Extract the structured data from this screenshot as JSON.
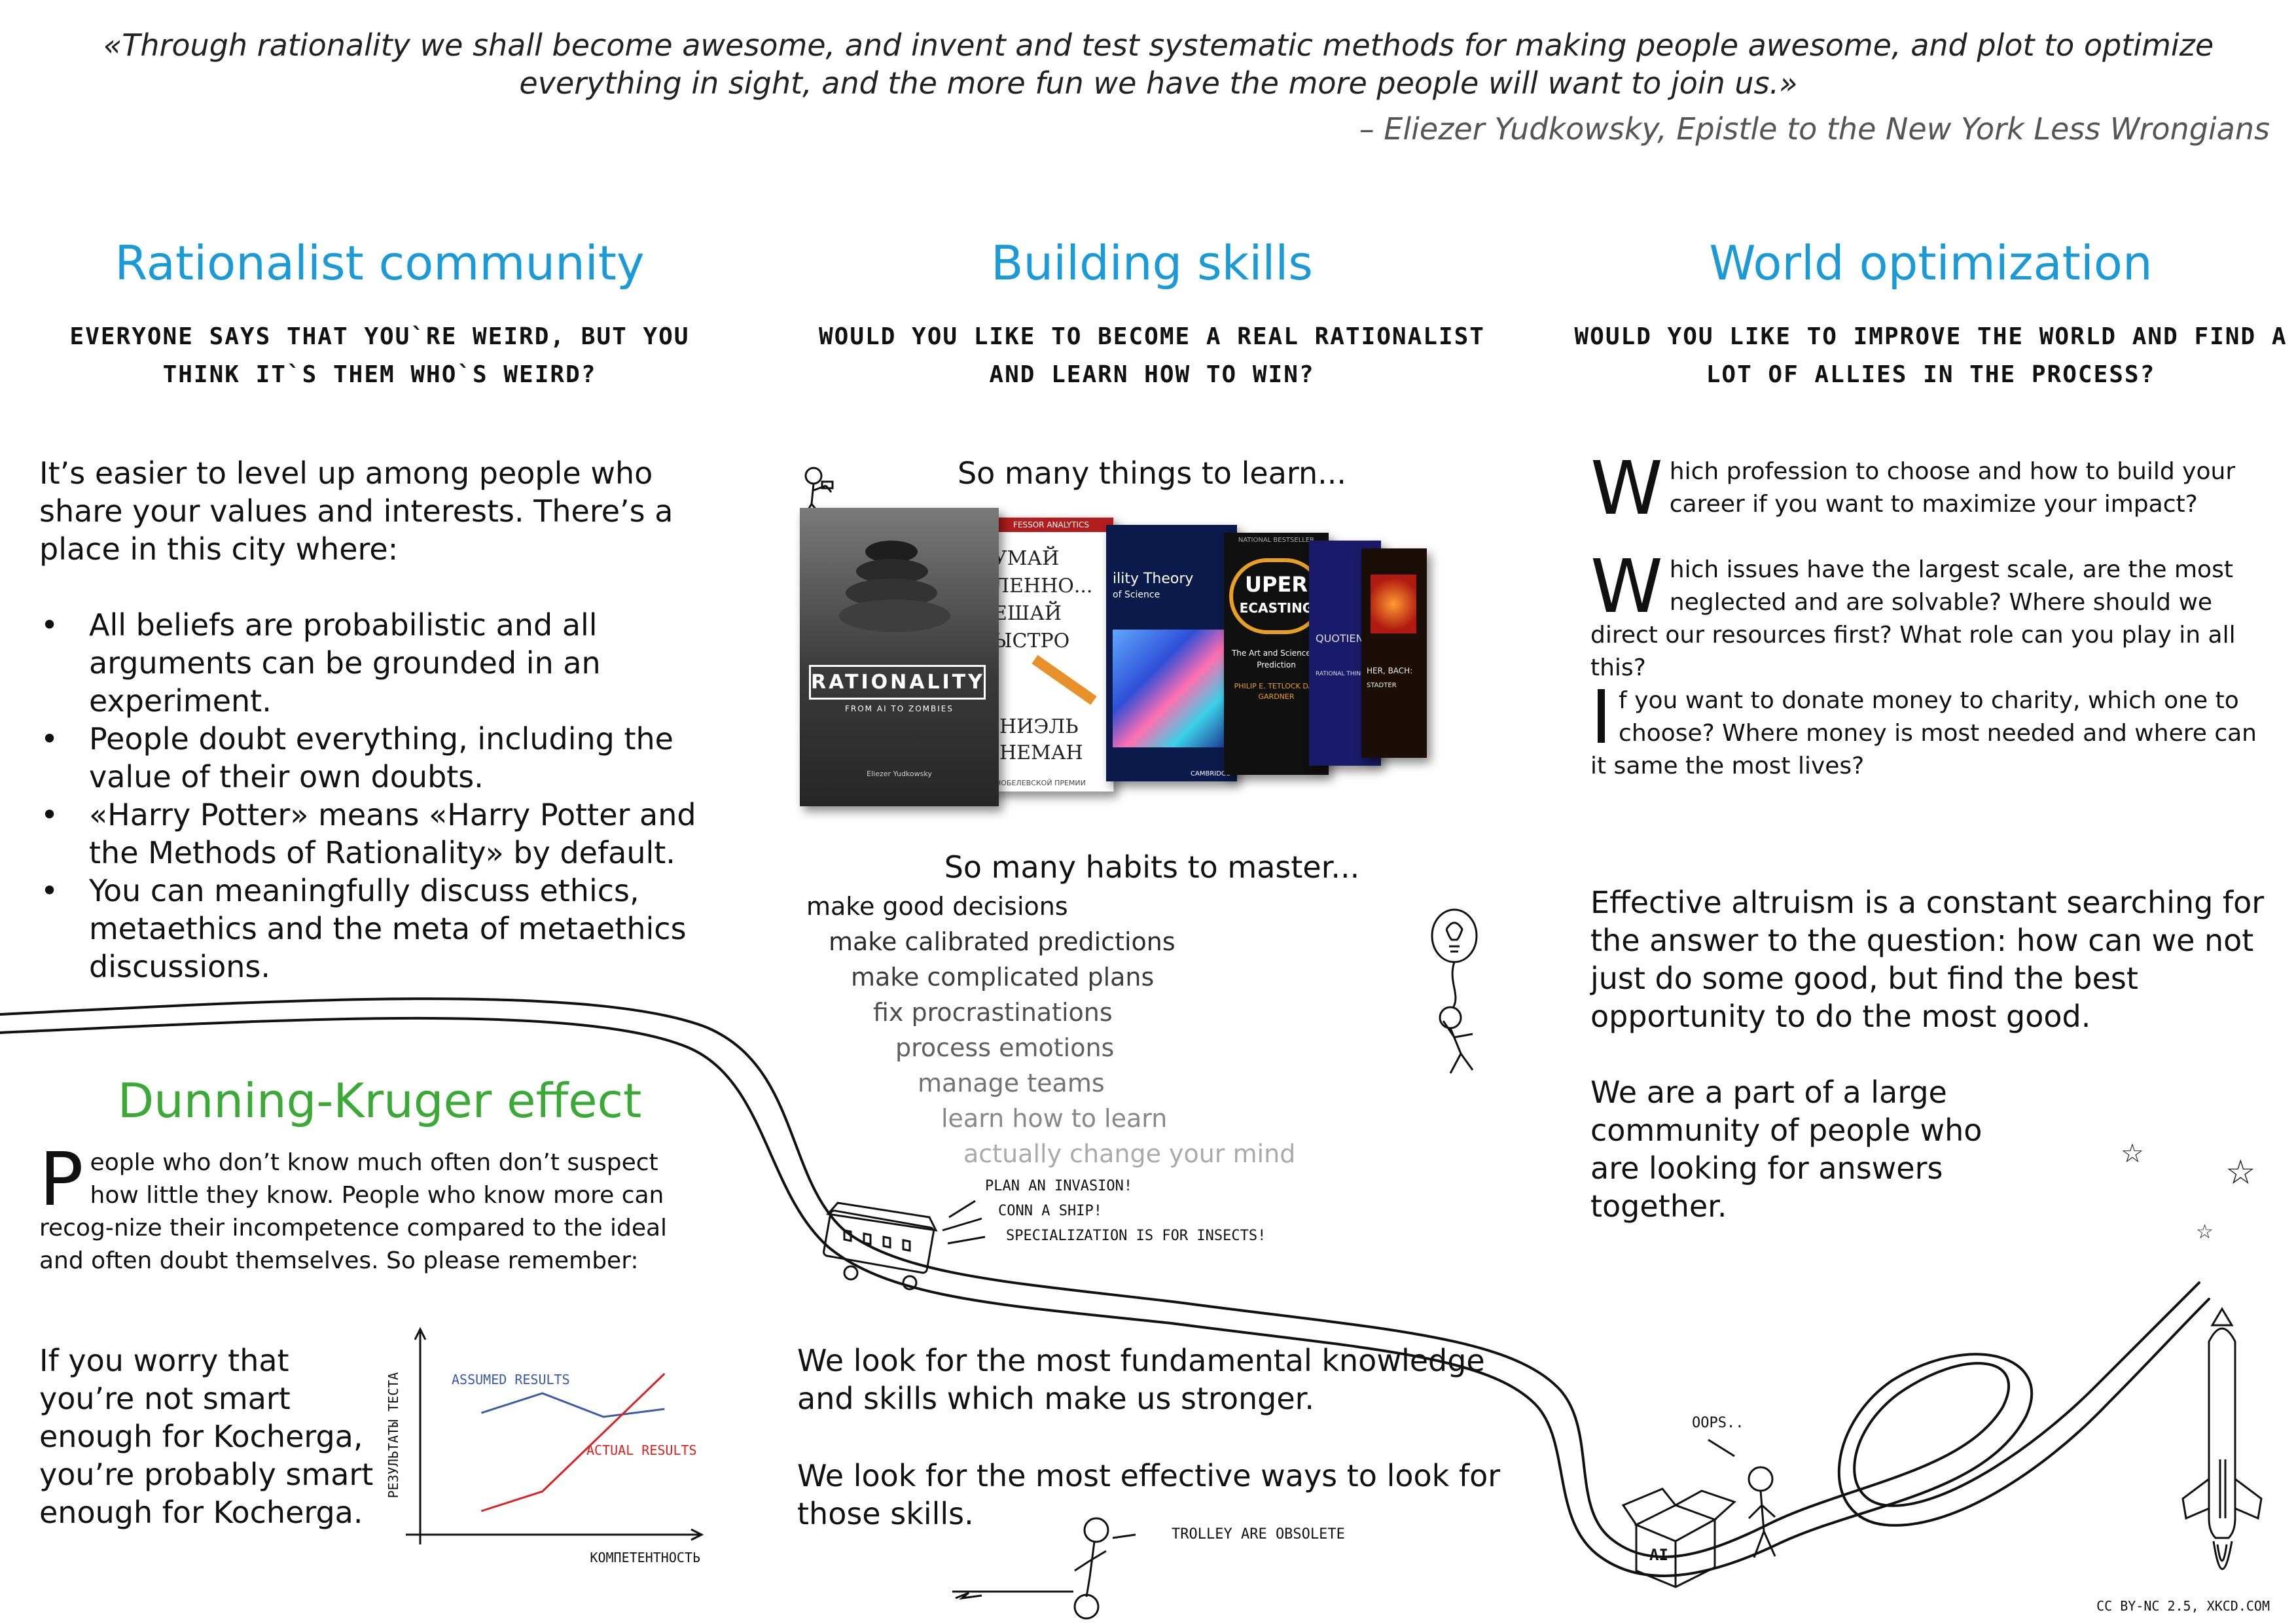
{
  "quote": {
    "text": "«Through rationality we shall become awesome, and invent and test systematic methods for making people awesome, and plot to optimize everything in sight, and the more fun we have the more people will want to join us.»",
    "attribution": "– Eliezer Yudkowsky, Epistle to the New York Less Wrongians"
  },
  "colors": {
    "heading_blue": "#1a9ad6",
    "heading_green": "#3aa935",
    "chart_blue": "#3a5aa8",
    "chart_red": "#e02020"
  },
  "community": {
    "title": "Rationalist community",
    "subtitle": "Everyone says that you`re weird, but you think it`s them who`s weird?",
    "intro": "It’s easier to level up among people who share your values and interests. There’s a place in this city where:",
    "bullets": [
      "All beliefs are probabilistic and all arguments can be grounded in an experiment.",
      "People doubt everything, including the value of their own doubts.",
      "«Harry Potter» means «Harry Potter and the Methods of Rationality» by default.",
      "You can meaningfully discuss ethics, metaethics and the meta of metaethics discussions."
    ]
  },
  "dunning": {
    "title": "Dunning-Kruger effect",
    "dropcap": "P",
    "text": "eople who don’t know much often don’t suspect how little they know. People who know more can recog-nize their incompetence compared to the ideal and often doubt themselves. So please remember:",
    "worry": "If you worry that you’re not smart enough for Kocherga, you’re probably smart enough for Kocherga."
  },
  "chart_data": {
    "type": "line",
    "xlabel": "КОМПЕТЕНТНОСТЬ",
    "ylabel": "РЕЗУЛЬТАТЫ ТЕСТА",
    "series": [
      {
        "name": "ASSUMED RESULTS",
        "color": "#3a5aa8",
        "x": [
          1,
          2,
          3,
          4
        ],
        "y": [
          6.2,
          7.2,
          6.0,
          6.4
        ]
      },
      {
        "name": "ACTUAL RESULTS",
        "color": "#e02020",
        "x": [
          1,
          2,
          3,
          4
        ],
        "y": [
          1.2,
          2.2,
          5.2,
          8.2
        ]
      }
    ],
    "xlim": [
      0,
      4.5
    ],
    "ylim": [
      0,
      10
    ],
    "grid": false
  },
  "skills": {
    "title": "Building skills",
    "subtitle": "Would you like to become a real rationalist and learn how to win?",
    "things_heading": "So many things to learn...",
    "books": [
      {
        "title": "RATIONALITY",
        "subtitle": "FROM AI TO ZOMBIES",
        "author": "Eliezer Yudkowsky"
      },
      {
        "lines": [
          "УМАЙ",
          "ЛЕННО...",
          "ЕШАЙ",
          "ЫСТРО"
        ],
        "author_lines": [
          "НИЭЛЬ",
          "НЕМАН"
        ],
        "top": "FESSOR ANALYTICS",
        "bottom": "НОБЕЛЕВСКОЙ ПРЕМИИ"
      },
      {
        "title": "ility Theory",
        "subtitle": "of Science",
        "publisher": "CAMBRIDGE"
      },
      {
        "title_lines": [
          "UPER",
          "ECASTING"
        ],
        "subtitle": "The Art and Science of Prediction",
        "authors": "PHILIP E. TETLOCK DAN GARDNER",
        "top": "NATIONAL BESTSELLER"
      },
      {
        "title": "QUOTIENT",
        "subtitle": "RATIONAL THINKING"
      },
      {
        "lines": [
          "HER, BACH:"
        ],
        "author": "STADTER"
      }
    ],
    "habits_heading": "So many habits to master...",
    "habits": [
      "make good decisions",
      "make calibrated predictions",
      "make complicated plans",
      "fix procrastinations",
      "process emotions",
      "manage teams",
      "learn how to learn",
      "actually change your mind"
    ],
    "trolley_notes": [
      "PLAN AN INVASION!",
      "CONN A SHIP!",
      "SPECIALIZATION IS FOR INSECTS!"
    ],
    "closing1": "We look for the most fundamental knowledge and skills which make us stronger.",
    "closing2": "We look for the most effective ways to look for those skills.",
    "trolley_caption": "TROLLEY ARE OBSOLETE"
  },
  "world": {
    "title": "World optimization",
    "subtitle": "Would you like to improve the world and find a lot of allies in the process?",
    "paragraphs": [
      {
        "dropcap": "W",
        "text": "hich profession to choose and how to build your career if you want to maximize your impact?"
      },
      {
        "dropcap": "W",
        "text": "hich issues have the largest scale, are the most neglected and are solvable? Where should we direct our resources first? What role can you play in all this?"
      },
      {
        "dropcap": "I",
        "text": "f you want to donate money to charity, which one to choose? Where money is most needed and where can it same the most lives?"
      }
    ],
    "ea": "Effective altruism is a constant searching for the answer to the question: how can we not just do some good, but find the best opportunity to do the most good.",
    "community": "We are a part of a large community of people who are looking for answers together.",
    "oops": "OOPS..",
    "box_label": "AI"
  },
  "credit": "CC BY-NC 2.5, XKCD.COM"
}
